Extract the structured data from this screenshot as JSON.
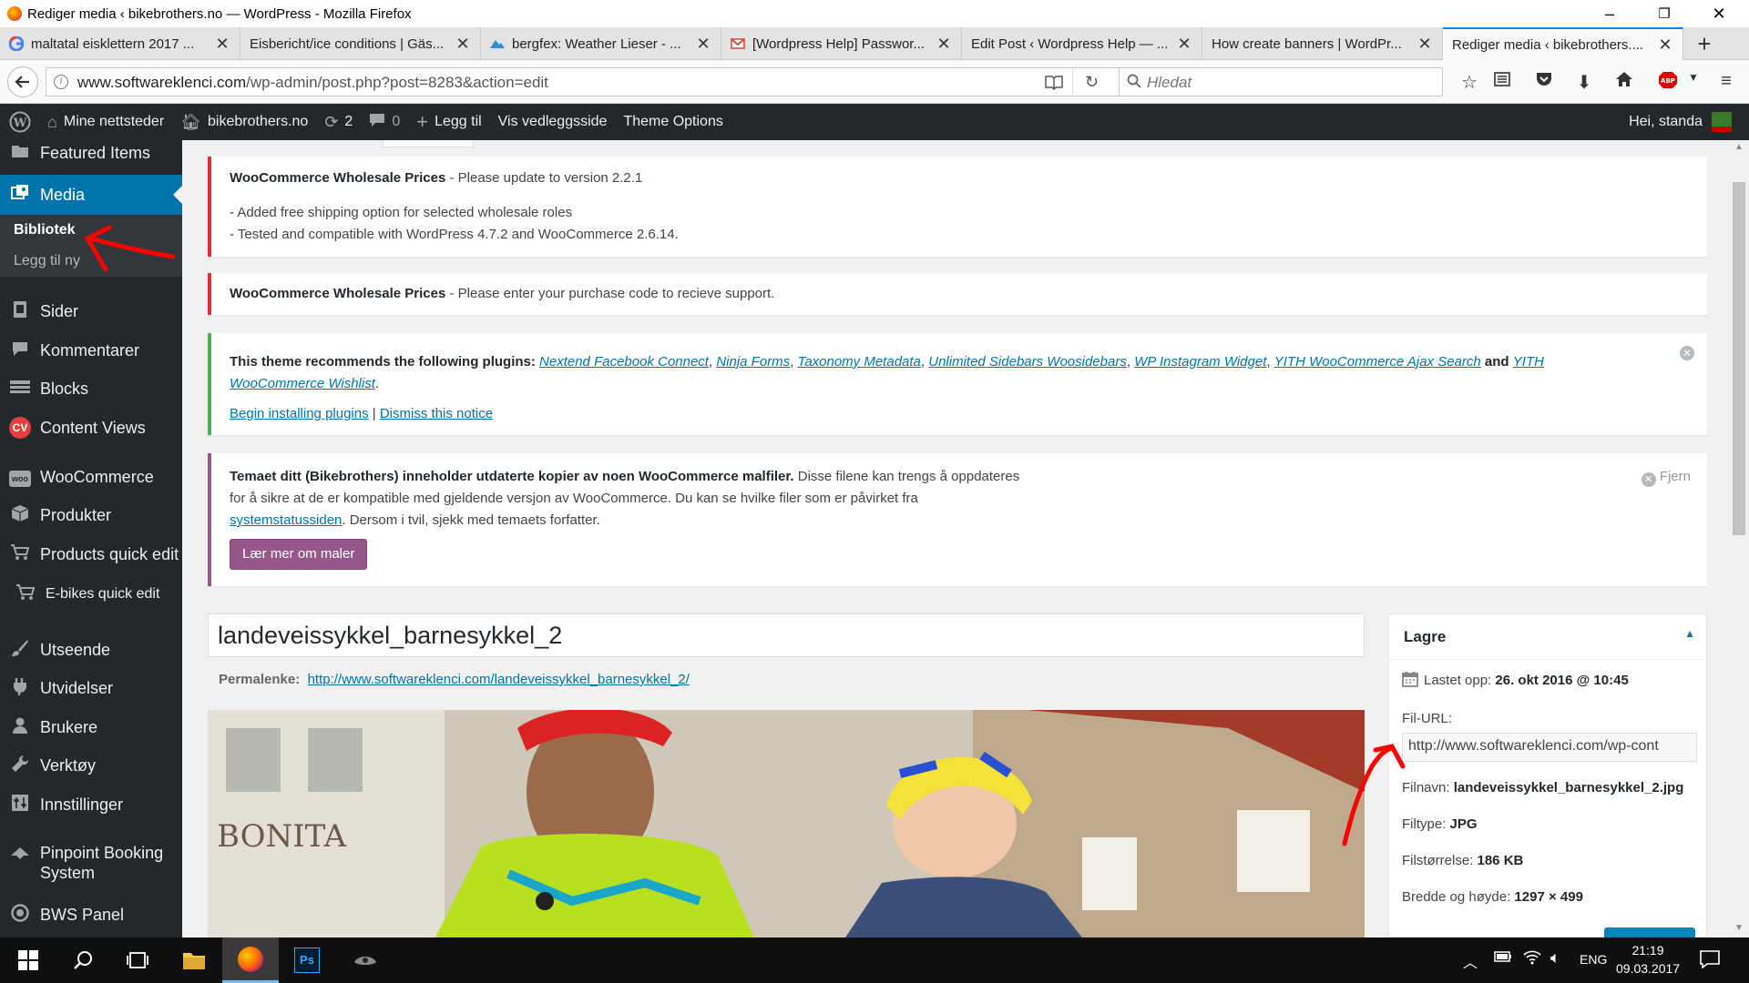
{
  "window": {
    "title": "Rediger media ‹ bikebrothers.no — WordPress - Mozilla Firefox",
    "minimize": "–",
    "maximize": "❐",
    "close": "✕"
  },
  "tabs": [
    {
      "label": "maltatal eisklettern 2017 ...",
      "icon": "google-icon"
    },
    {
      "label": "Eisbericht/ice conditions | Gäs...",
      "icon": "page-icon"
    },
    {
      "label": "bergfex: Weather Lieser - ...",
      "icon": "bergfex-icon"
    },
    {
      "label": "[Wordpress Help] Passwor...",
      "icon": "gmail-icon"
    },
    {
      "label": "Edit Post ‹ Wordpress Help — ...",
      "icon": "page-icon"
    },
    {
      "label": "How create banners | WordPr...",
      "icon": "page-icon"
    },
    {
      "label": "Rediger media ‹ bikebrothers....",
      "icon": "page-icon",
      "active": true
    }
  ],
  "tab_close": "✕",
  "new_tab": "+",
  "navbar": {
    "url_host": "www.softwareklenci.com",
    "url_path": "/wp-admin/post.php?post=8283&action=edit",
    "search_placeholder": "Hledat"
  },
  "adminbar": {
    "my_sites": "Mine nettsteder",
    "site_name": "bikebrothers.no",
    "updates_count": "2",
    "comments_count": "0",
    "add_new": "Legg til",
    "view_attachment": "Vis vedleggsside",
    "theme_options": "Theme Options",
    "greeting": "Hei, standa"
  },
  "sidebar": {
    "items": [
      {
        "label": "Featured Items",
        "icon": "folder-icon"
      },
      {
        "label": "Media",
        "icon": "media-icon",
        "current": true
      },
      {
        "label": "Sider",
        "icon": "page-icon"
      },
      {
        "label": "Kommentarer",
        "icon": "comment-icon"
      },
      {
        "label": "Blocks",
        "icon": "blocks-icon"
      },
      {
        "label": "Content Views",
        "icon": "cv-icon"
      },
      {
        "label": "WooCommerce",
        "icon": "woo-icon"
      },
      {
        "label": "Produkter",
        "icon": "box-icon"
      },
      {
        "label": "Products quick edit",
        "icon": "cart-icon"
      },
      {
        "label": "E-bikes quick edit",
        "icon": "cart-icon"
      },
      {
        "label": "Utseende",
        "icon": "brush-icon"
      },
      {
        "label": "Utvidelser",
        "icon": "plugin-icon"
      },
      {
        "label": "Brukere",
        "icon": "user-icon"
      },
      {
        "label": "Verktøy",
        "icon": "wrench-icon"
      },
      {
        "label": "Innstillinger",
        "icon": "settings-icon"
      },
      {
        "label": "Pinpoint Booking System",
        "icon": "booking-icon"
      },
      {
        "label": "BWS Panel",
        "icon": "bws-icon"
      }
    ],
    "submenu": {
      "library": "Bibliotek",
      "add_new": "Legg til ny"
    }
  },
  "notices": {
    "wholesale_update": {
      "plugin": "WooCommerce Wholesale Prices",
      "message": " - Please update to version 2.2.1",
      "line1": "- Added free shipping option for selected wholesale roles",
      "line2": "- Tested and compatible with WordPress 4.7.2 and WooCommerce 2.6.14."
    },
    "wholesale_code": {
      "plugin": "WooCommerce Wholesale Prices",
      "message": " - Please enter your purchase code to recieve support."
    },
    "theme_plugins": {
      "lead": "This theme recommends the following plugins: ",
      "plugins": [
        "Nextend Facebook Connect",
        "Ninja Forms",
        "Taxonomy Metadata",
        "Unlimited Sidebars Woosidebars",
        "WP Instagram Widget",
        "YITH WooCommerce Ajax Search"
      ],
      "and": " and ",
      "last_plugin": "YITH WooCommerce Wishlist",
      "begin": "Begin installing plugins",
      "sep": " | ",
      "dismiss": "Dismiss this notice"
    },
    "woo_templates": {
      "bold": "Temaet ditt (Bikebrothers) inneholder utdaterte kopier av noen WooCommerce malfiler.",
      "text1": " Disse filene kan trengs å oppdateres for å sikre at de er kompatible med gjeldende versjon av WooCommerce. Du kan se hvilke filer som er påvirket fra ",
      "link": "systemstatussiden",
      "text2": ". Dersom i tvil, sjekk med temaets forfatter.",
      "button": "Lær mer om maler",
      "dismiss": "Fjern"
    }
  },
  "post": {
    "title": "landeveissykkel_barnesykkel_2",
    "permalink_label": "Permalenke:",
    "permalink_url": "http://www.softwareklenci.com/landeveissykkel_barnesykkel_2/",
    "photo_sign": "BONITA"
  },
  "metabox": {
    "title": "Lagre",
    "uploaded_label": "Lastet opp: ",
    "uploaded_value": "26. okt 2016 @ 10:45",
    "file_url_label": "Fil-URL:",
    "file_url_value": "http://www.softwareklenci.com/wp-cont",
    "filename_label": "Filnavn: ",
    "filename_value": "landeveissykkel_barnesykkel_2.jpg",
    "filetype_label": "Filtype: ",
    "filetype_value": "JPG",
    "filesize_label": "Filstørrelse: ",
    "filesize_value": "186 KB",
    "dimensions_label": "Bredde og høyde: ",
    "dimensions_value": "1297 × 499"
  },
  "taskbar": {
    "lang": "ENG",
    "time": "21:19",
    "date": "09.03.2017"
  },
  "colors": {
    "accent": "#0073aa",
    "admin_bg": "#23282d",
    "error": "#dc3232",
    "success": "#46b450",
    "woo_purple": "#96588a",
    "annotation_red": "#ff0000"
  }
}
